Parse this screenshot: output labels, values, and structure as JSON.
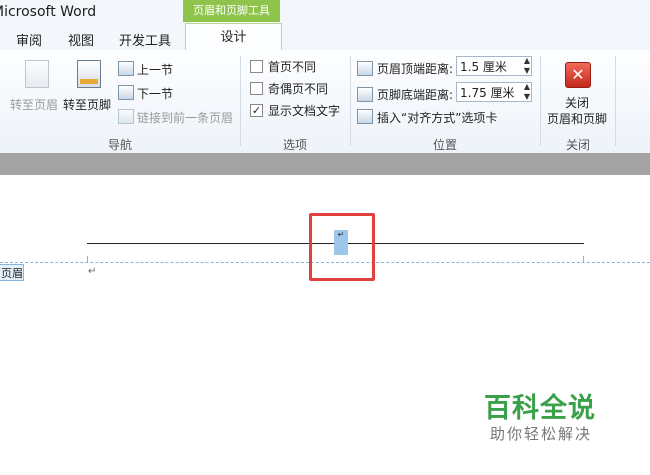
{
  "window": {
    "title": "Microsoft Word"
  },
  "context_tab": "页眉和页脚工具",
  "tabs": [
    {
      "label": "审阅"
    },
    {
      "label": "视图"
    },
    {
      "label": "开发工具"
    },
    {
      "label": "设计",
      "active": true
    }
  ],
  "ribbon": {
    "nav": {
      "goto_header": "转至页眉",
      "goto_footer": "转至页脚",
      "prev_section": "上一节",
      "next_section": "下一节",
      "link_previous": "链接到前一条页眉",
      "group_label": "导航"
    },
    "options": {
      "first_page": {
        "label": "首页不同",
        "checked": false
      },
      "odd_even": {
        "label": "奇偶页不同",
        "checked": false
      },
      "show_text": {
        "label": "显示文档文字",
        "checked": true,
        "mark": "✓"
      },
      "group_label": "选项"
    },
    "position": {
      "header_dist_label": "页眉顶端距离:",
      "header_dist_value": "1.5 厘米",
      "footer_dist_label": "页脚底端距离:",
      "footer_dist_value": "1.75 厘米",
      "insert_tab": "插入“对齐方式”选项卡",
      "group_label": "位置"
    },
    "close": {
      "button_line1": "关闭",
      "button_line2": "页眉和页脚",
      "group_label": "关闭"
    }
  },
  "document": {
    "header_tag": "页眉",
    "paragraph_mark": "↵",
    "cursor_mark": "↵"
  },
  "watermark": {
    "title": "百科全说",
    "subtitle": "助你轻松解决"
  },
  "colors": {
    "context_tab": "#8ec44b",
    "highlight_box": "#e0403e",
    "selection": "#9dc6ea",
    "watermark_green": "#3aa14a"
  }
}
